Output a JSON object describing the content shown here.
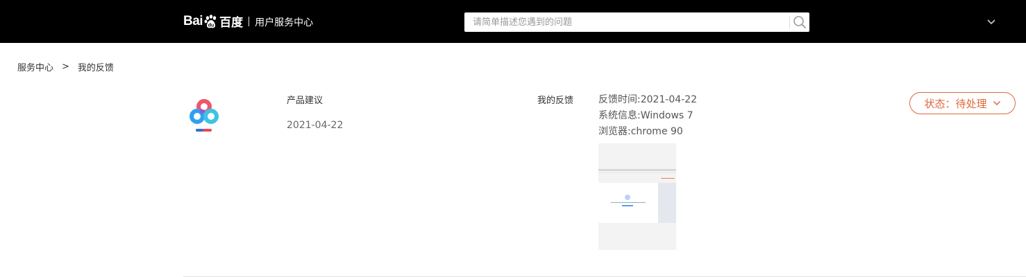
{
  "header": {
    "logo_latin": "Bai",
    "logo_cn": "百度",
    "subtitle": "用户服务中心",
    "search_placeholder": "请简单描述您遇到的问题",
    "search_value": "",
    "icons": {
      "search": "search-icon",
      "menu": "chevron-down-icon",
      "logo": "baidu-paw-icon"
    },
    "bg_color": "#000000"
  },
  "breadcrumb": {
    "items": [
      "服务中心",
      "我的反馈"
    ],
    "separator": ">"
  },
  "feedback": {
    "product_title": "产品建议",
    "date": "2021-04-22",
    "section_label": "我的反馈",
    "meta": {
      "time_label": "反馈时间:",
      "time_value": "2021-04-22",
      "system_label": "系统信息:",
      "system_value": "Windows 7",
      "browser_label": "浏览器:",
      "browser_value": "chrome 90"
    },
    "status_label": "状态：待处理",
    "status_color": "#e0653a",
    "app_icon": "baidu-netdisk-icon",
    "thumbnail": "screenshot-thumbnail"
  }
}
